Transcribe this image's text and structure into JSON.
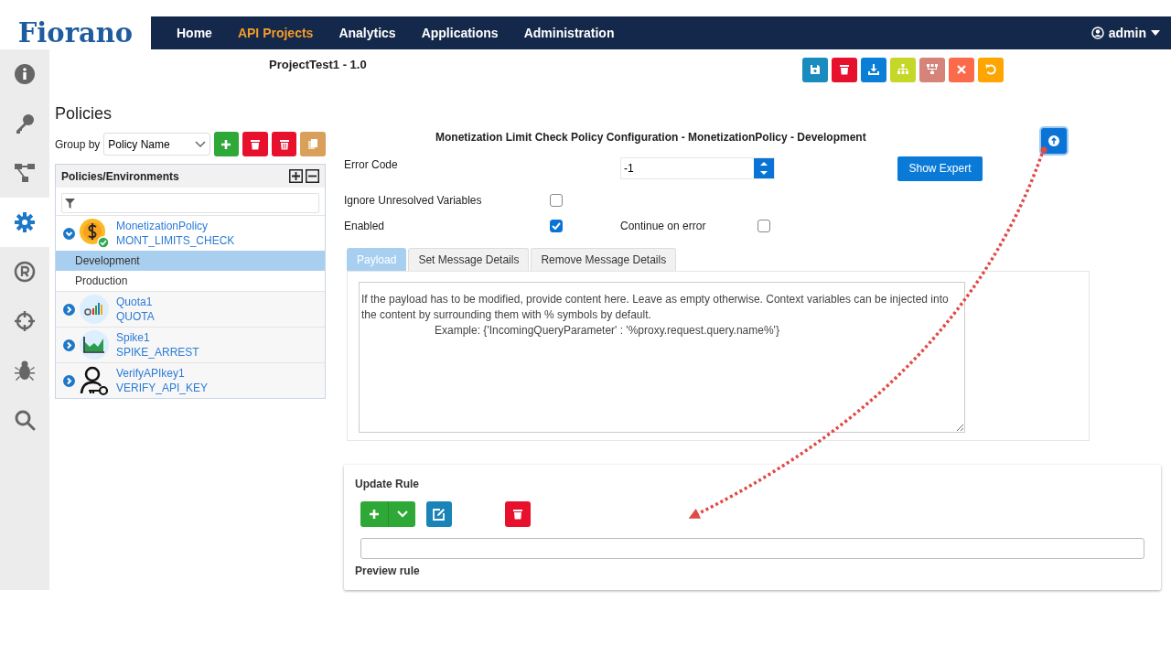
{
  "logo": {
    "text": "Fiorano"
  },
  "nav": {
    "items": [
      {
        "label": "Home",
        "selected": false
      },
      {
        "label": "API Projects",
        "selected": true
      },
      {
        "label": "Analytics",
        "selected": false
      },
      {
        "label": "Applications",
        "selected": false
      },
      {
        "label": "Administration",
        "selected": false
      }
    ],
    "user": "admin"
  },
  "sidebar": {
    "items": [
      {
        "kind": "info",
        "selected": false
      },
      {
        "kind": "key",
        "selected": false
      },
      {
        "kind": "hierarchy",
        "selected": false
      },
      {
        "kind": "gear",
        "selected": true
      },
      {
        "kind": "registered",
        "selected": false
      },
      {
        "kind": "crosshair",
        "selected": false
      },
      {
        "kind": "bug",
        "selected": false
      },
      {
        "kind": "search",
        "selected": false
      }
    ]
  },
  "project": {
    "title": "ProjectTest1 - 1.0"
  },
  "toolbar": [
    {
      "kind": "save"
    },
    {
      "kind": "delete"
    },
    {
      "kind": "download"
    },
    {
      "kind": "sitemap"
    },
    {
      "kind": "tree"
    },
    {
      "kind": "close"
    },
    {
      "kind": "undo"
    }
  ],
  "policies": {
    "title": "Policies",
    "group_by_label": "Group by",
    "group_by_value": "Policy Name",
    "actions": [
      {
        "kind": "add"
      },
      {
        "kind": "delete"
      },
      {
        "kind": "delete-all"
      },
      {
        "kind": "copy"
      }
    ],
    "tree_header": "Policies/Environments",
    "items": [
      {
        "name": "MonetizationPolicy",
        "type": "MONT_LIMITS_CHECK",
        "kind": "money",
        "expanded": true,
        "children": [
          {
            "label": "Development",
            "selected": true
          },
          {
            "label": "Production",
            "selected": false
          }
        ]
      },
      {
        "name": "Quota1",
        "type": "QUOTA",
        "kind": "quota",
        "expanded": false
      },
      {
        "name": "Spike1",
        "type": "SPIKE_ARREST",
        "kind": "spike",
        "expanded": false
      },
      {
        "name": "VerifyAPIkey1",
        "type": "VERIFY_API_KEY",
        "kind": "key",
        "expanded": false
      }
    ]
  },
  "config": {
    "title": "Monetization Limit Check Policy Configuration - MonetizationPolicy - Development",
    "error_code_label": "Error Code",
    "error_code_value": "-1",
    "show_expert": "Show Expert",
    "ignore_label": "Ignore Unresolved Variables",
    "ignore_checked": false,
    "enabled_label": "Enabled",
    "enabled_checked": true,
    "continue_label": "Continue on error",
    "continue_checked": false,
    "tabs": [
      {
        "label": "Payload",
        "selected": true
      },
      {
        "label": "Set Message Details",
        "selected": false
      },
      {
        "label": "Remove Message Details",
        "selected": false
      }
    ],
    "payload_placeholder": "If the payload has to be modified, provide content here. Leave as empty otherwise. Context variables can be injected into the content by surrounding them with % symbols by default.\n                        Example: {'IncomingQueryParameter' : '%proxy.request.query.name%'}"
  },
  "update_rule": {
    "title": "Update Rule",
    "preview_label": "Preview rule"
  }
}
